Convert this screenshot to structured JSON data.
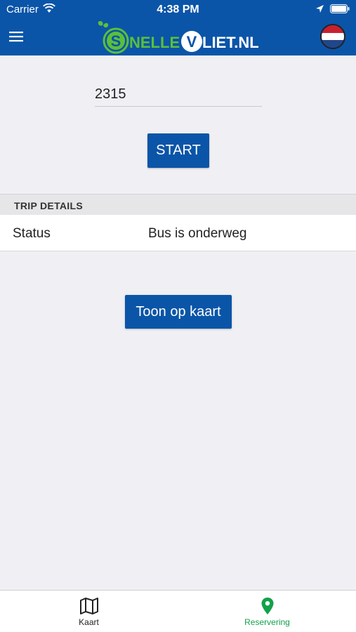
{
  "status_bar": {
    "carrier": "Carrier",
    "time": "4:38 PM"
  },
  "header": {
    "logo_text": "SNELLEVLIET.NL",
    "language": "nl"
  },
  "form": {
    "code_value": "2315",
    "start_label": "START"
  },
  "trip_details": {
    "section_title": "TRIP DETAILS",
    "rows": [
      {
        "label": "Status",
        "value": "Bus is onderweg"
      }
    ]
  },
  "map_button_label": "Toon op kaart",
  "tabs": [
    {
      "label": "Kaart",
      "icon": "map-icon",
      "active": false
    },
    {
      "label": "Reservering",
      "icon": "location-pin-icon",
      "active": true
    }
  ],
  "colors": {
    "primary": "#0a55a8",
    "accent_green": "#12a14a",
    "background": "#efeff4"
  }
}
